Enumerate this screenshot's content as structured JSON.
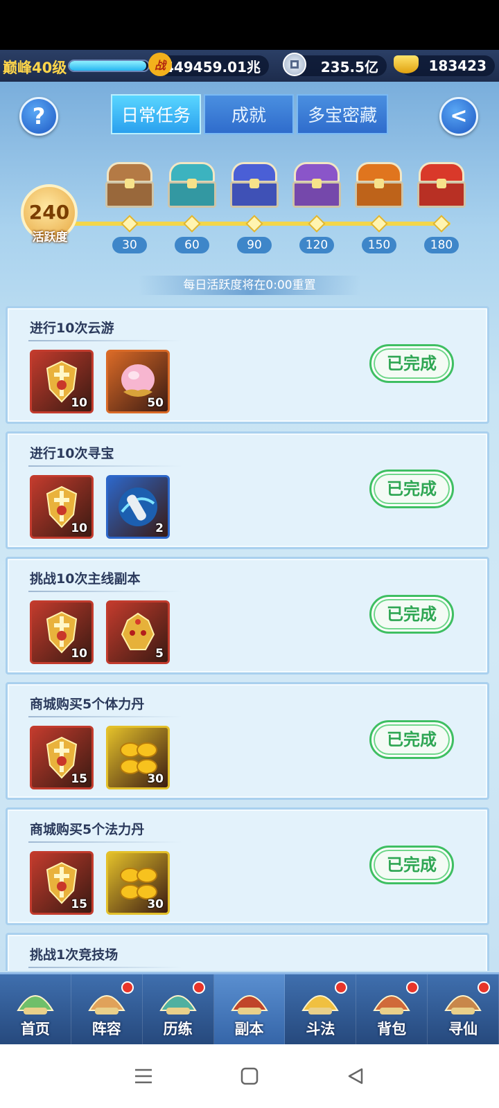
{
  "resources": {
    "level": "巅峰40级",
    "exp_fraction": 0.97,
    "combat_icon": "战",
    "combat_power": "449459.01兆",
    "coin_value": "235.5亿",
    "ingot_value": "183423"
  },
  "header": {
    "help_icon": "?",
    "back_icon": "<",
    "tabs": [
      {
        "label": "日常任务",
        "active": true
      },
      {
        "label": "成就",
        "active": false
      },
      {
        "label": "多宝密藏",
        "active": false
      }
    ]
  },
  "activity": {
    "score": "240",
    "score_label": "活跃度",
    "milestones": [
      "30",
      "60",
      "90",
      "120",
      "150",
      "180"
    ],
    "chest_colors": [
      "#b47a45",
      "#3cb3bf",
      "#4a5fd6",
      "#8a55c9",
      "#e0751e",
      "#d9392a"
    ],
    "reset_note": "每日活跃度将在0:00重置"
  },
  "tasks": [
    {
      "title": "进行10次云游",
      "button": "已完成",
      "rewards": [
        {
          "icon": "sword-shield-icon",
          "count": "10",
          "frame": "#c23b2d"
        },
        {
          "icon": "peach-icon",
          "count": "50",
          "frame": "#d96a27"
        }
      ]
    },
    {
      "title": "进行10次寻宝",
      "button": "已完成",
      "rewards": [
        {
          "icon": "sword-shield-icon",
          "count": "10",
          "frame": "#c23b2d"
        },
        {
          "icon": "scroll-icon",
          "count": "2",
          "frame": "#2d67c9"
        }
      ]
    },
    {
      "title": "挑战10次主线副本",
      "button": "已完成",
      "rewards": [
        {
          "icon": "sword-shield-icon",
          "count": "10",
          "frame": "#c23b2d"
        },
        {
          "icon": "dragon-mask-icon",
          "count": "5",
          "frame": "#c23b2d"
        }
      ]
    },
    {
      "title": "商城购买5个体力丹",
      "button": "已完成",
      "rewards": [
        {
          "icon": "sword-shield-icon",
          "count": "15",
          "frame": "#c23b2d"
        },
        {
          "icon": "gold-ingots-icon",
          "count": "30",
          "frame": "#e3c02a"
        }
      ]
    },
    {
      "title": "商城购买5个法力丹",
      "button": "已完成",
      "rewards": [
        {
          "icon": "sword-shield-icon",
          "count": "15",
          "frame": "#c23b2d"
        },
        {
          "icon": "gold-ingots-icon",
          "count": "30",
          "frame": "#e3c02a"
        }
      ]
    },
    {
      "title": "挑战1次竞技场",
      "button": "",
      "rewards": []
    }
  ],
  "nav": [
    {
      "label": "首页",
      "icon": "home-icon",
      "badge": false,
      "active": false
    },
    {
      "label": "阵容",
      "icon": "lineup-icon",
      "badge": true,
      "active": false
    },
    {
      "label": "历练",
      "icon": "training-icon",
      "badge": true,
      "active": false
    },
    {
      "label": "副本",
      "icon": "dungeon-icon",
      "badge": false,
      "active": true
    },
    {
      "label": "斗法",
      "icon": "duel-icon",
      "badge": true,
      "active": false
    },
    {
      "label": "背包",
      "icon": "bag-icon",
      "badge": true,
      "active": false
    },
    {
      "label": "寻仙",
      "icon": "seek-immortal-icon",
      "badge": true,
      "active": false
    }
  ]
}
